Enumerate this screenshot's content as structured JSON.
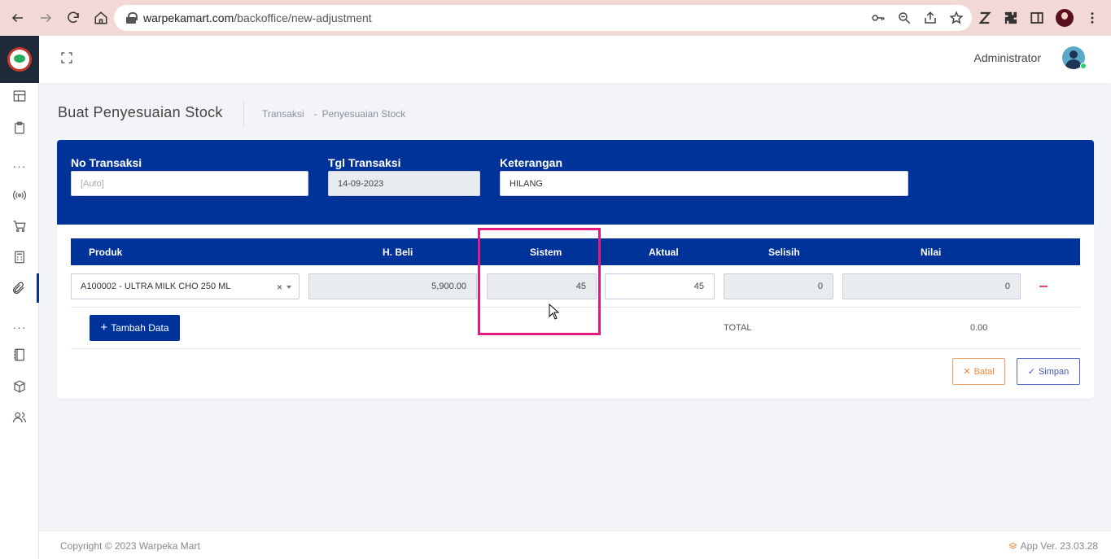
{
  "browser": {
    "url_domain": "warpekamart.com",
    "url_path": "/backoffice/new-adjustment"
  },
  "header": {
    "user_name": "Administrator"
  },
  "page": {
    "title": "Buat Penyesuaian Stock",
    "breadcrumb": [
      "Transaksi",
      "-",
      "Penyesuaian Stock"
    ]
  },
  "form": {
    "no_transaksi": {
      "label": "No Transaksi",
      "placeholder": "[Auto]",
      "value": ""
    },
    "tgl_transaksi": {
      "label": "Tgl Transaksi",
      "value": "14-09-2023"
    },
    "keterangan": {
      "label": "Keterangan",
      "value": "HILANG"
    }
  },
  "table": {
    "columns": [
      "Produk",
      "H. Beli",
      "Sistem",
      "Aktual",
      "Selisih",
      "Nilai"
    ],
    "rows": [
      {
        "produk": "A100002 - ULTRA MILK CHO 250 ML",
        "clear": "×",
        "h_beli": "5,900.00",
        "sistem": "45",
        "aktual": "45",
        "selisih": "0",
        "nilai": "0"
      }
    ],
    "add_label": "Tambah Data",
    "total_label": "TOTAL",
    "total_value": "0.00"
  },
  "actions": {
    "cancel_label": "Batal",
    "save_label": "Simpan"
  },
  "footer": {
    "copyright": "Copyright © 2023 Warpeka Mart",
    "version": "App Ver. 23.03.28"
  },
  "colors": {
    "primary": "#003399",
    "highlight": "#e6197f",
    "cancel": "#f08a3c"
  },
  "icons": [
    "back-icon",
    "forward-icon",
    "reload-icon",
    "home-icon",
    "lock-icon",
    "key-icon",
    "zoom-icon",
    "share-icon",
    "star-icon",
    "extension-icon",
    "fullscreen-icon"
  ]
}
